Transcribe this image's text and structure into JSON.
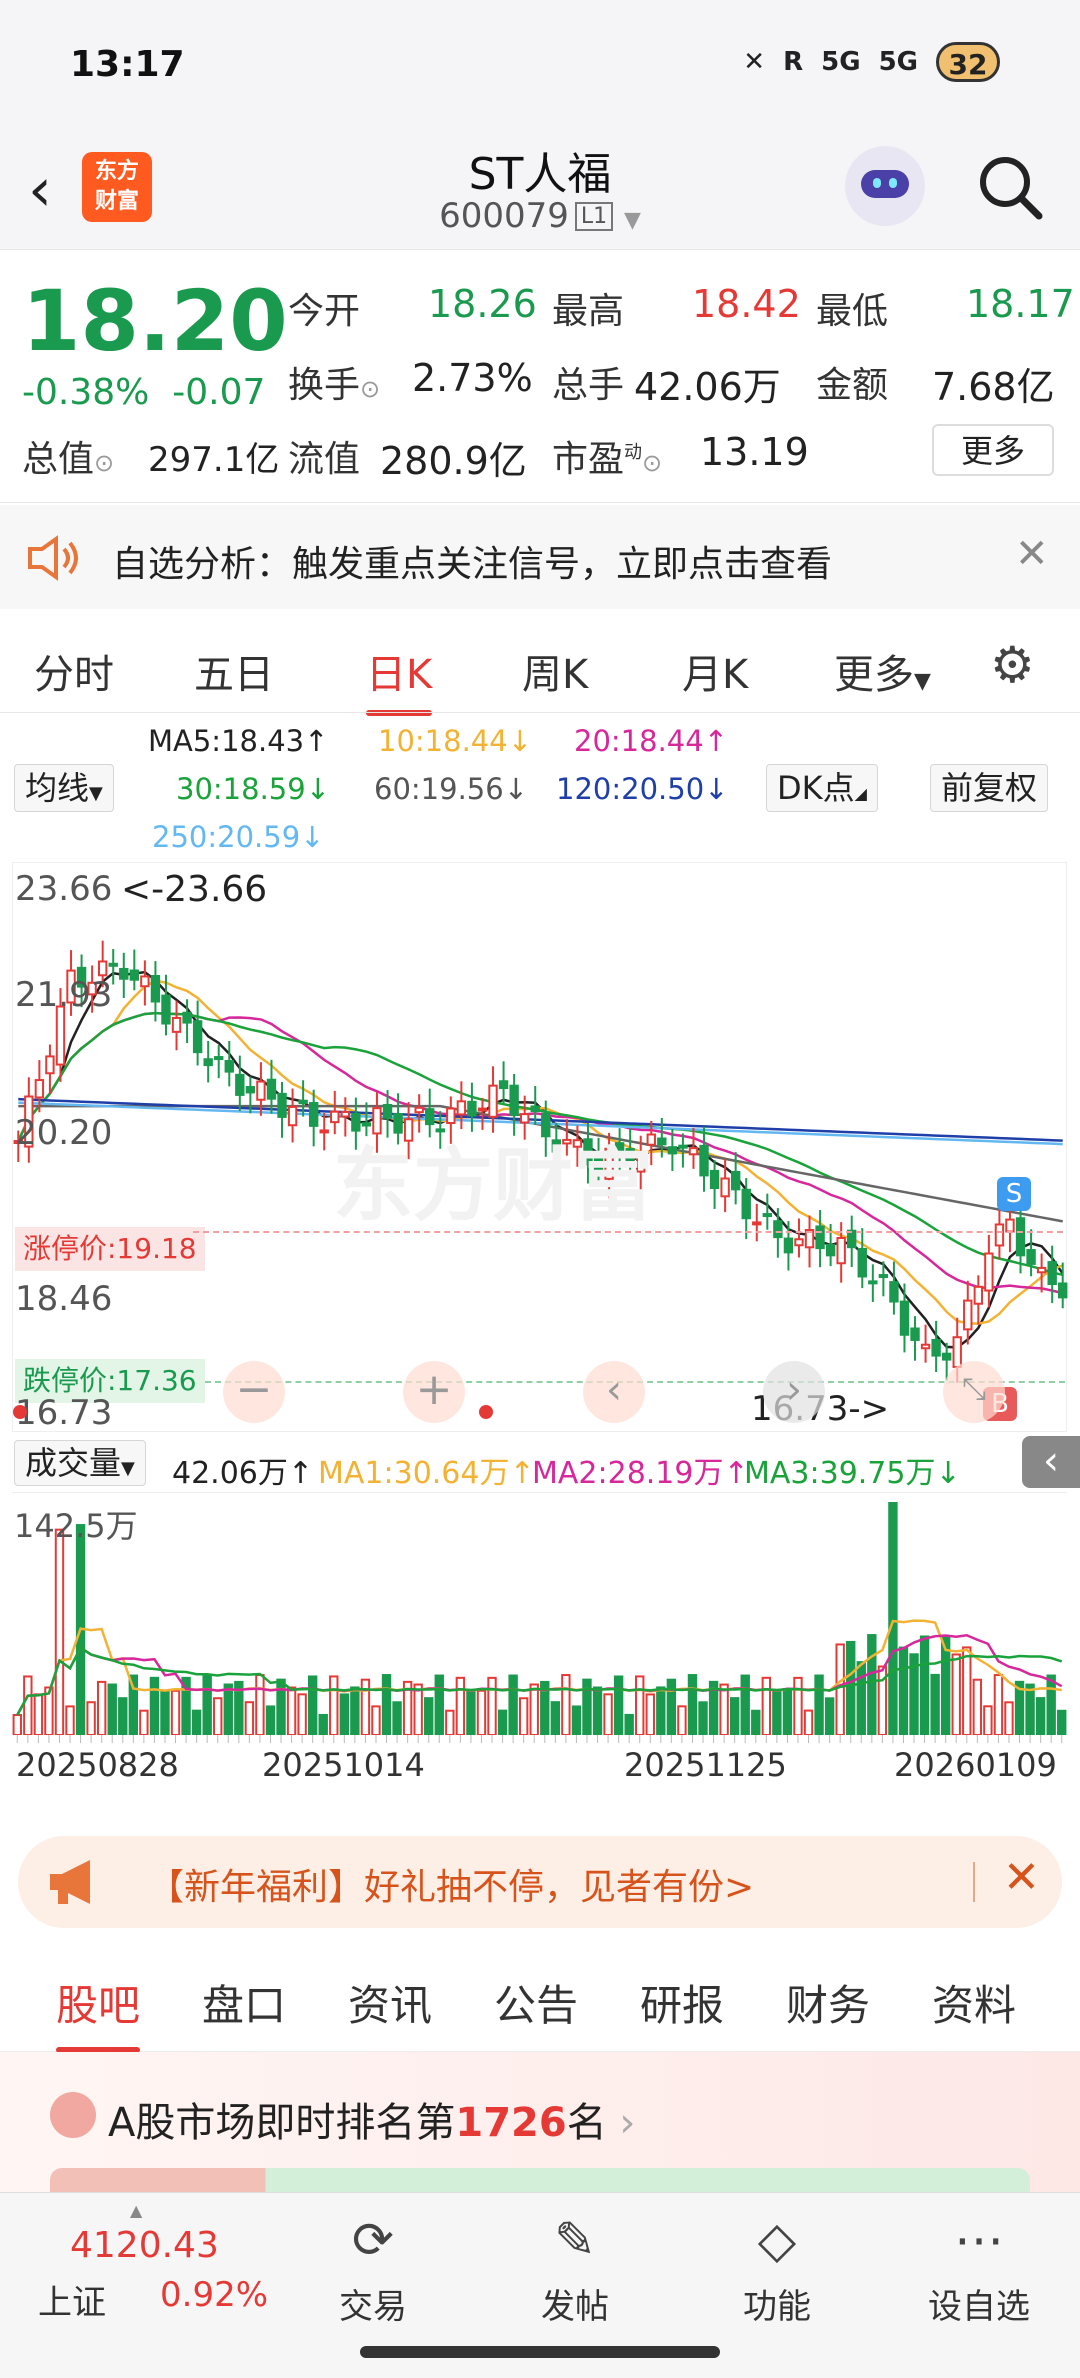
{
  "status": {
    "time": "13:17",
    "battery": "32",
    "net1": "5G",
    "net2": "5G",
    "roam": "R"
  },
  "header": {
    "title": "ST人福",
    "code": "600079",
    "level": "L1",
    "logo_line1": "东方",
    "logo_line2": "财富"
  },
  "quote": {
    "price": "18.20",
    "pct": "-0.38%",
    "chg": "-0.07",
    "open_label": "今开",
    "open": "18.26",
    "high_label": "最高",
    "high": "18.42",
    "low_label": "最低",
    "low": "18.17",
    "turnover_label": "换手",
    "turnover": "2.73%",
    "volume_label": "总手",
    "volume": "42.06万",
    "amount_label": "金额",
    "amount": "7.68亿",
    "mktcap_label": "总值",
    "mktcap": "297.1亿",
    "float_label": "流值",
    "float": "280.9亿",
    "pe_label": "市盈",
    "pe_sup": "动",
    "pe": "13.19",
    "more": "更多"
  },
  "notice": {
    "text": "自选分析：触发重点关注信号，立即点击查看"
  },
  "ktabs": [
    "分时",
    "五日",
    "日K",
    "周K",
    "月K",
    "更多"
  ],
  "ma": {
    "ma5": "MA5:18.43↑",
    "ma10": "10:18.44↓",
    "ma20": "20:18.44↑",
    "ma30": "30:18.59↓",
    "ma60": "60:19.56↓",
    "ma120": "120:20.50↓",
    "ma250": "250:20.59↓",
    "avg_select": "均线",
    "dk": "DK点",
    "adj": "前复权"
  },
  "chart": {
    "ylabels": [
      "23.66",
      "21.93",
      "20.20",
      "18.46",
      "16.73"
    ],
    "high_mark": "<-23.66",
    "low_mark": "16.73->",
    "limit_up": "涨停价:19.18",
    "limit_down": "跌停价:17.36",
    "sell_mark": "S",
    "buy_mark": "B"
  },
  "colors": {
    "up": "#e53935",
    "down": "#1a9a4e",
    "ma5": "#222222",
    "ma10": "#f2b233",
    "ma20": "#d6289b",
    "ma30": "#1aa33a",
    "ma60": "#666666",
    "ma120": "#1f3fa8",
    "ma250": "#63b8f2"
  },
  "chart_data": {
    "type": "candlestick",
    "ylim": [
      16.73,
      23.66
    ],
    "x_tick_labels": [
      "20250828",
      "20251014",
      "20251125",
      "20260109"
    ],
    "volume": {
      "label": "成交量",
      "current": "42.06万↑",
      "ma1": "MA1:30.64万↑",
      "ma2": "MA2:28.19万↑",
      "ma3": "MA3:39.75万↓",
      "max_label": "142.5万"
    }
  },
  "promo": {
    "text": "【新年福利】好礼抽不停，见者有份>"
  },
  "btabs": [
    "股吧",
    "盘口",
    "资讯",
    "公告",
    "研报",
    "财务",
    "资料"
  ],
  "rank": {
    "prefix": "A股市场即时排名第",
    "num": "1726",
    "suffix": "名"
  },
  "nav": {
    "index_value": "4120.43",
    "index_name": "上证",
    "index_pct": "0.92%",
    "trade": "交易",
    "post": "发帖",
    "func": "功能",
    "watch": "设自选"
  }
}
